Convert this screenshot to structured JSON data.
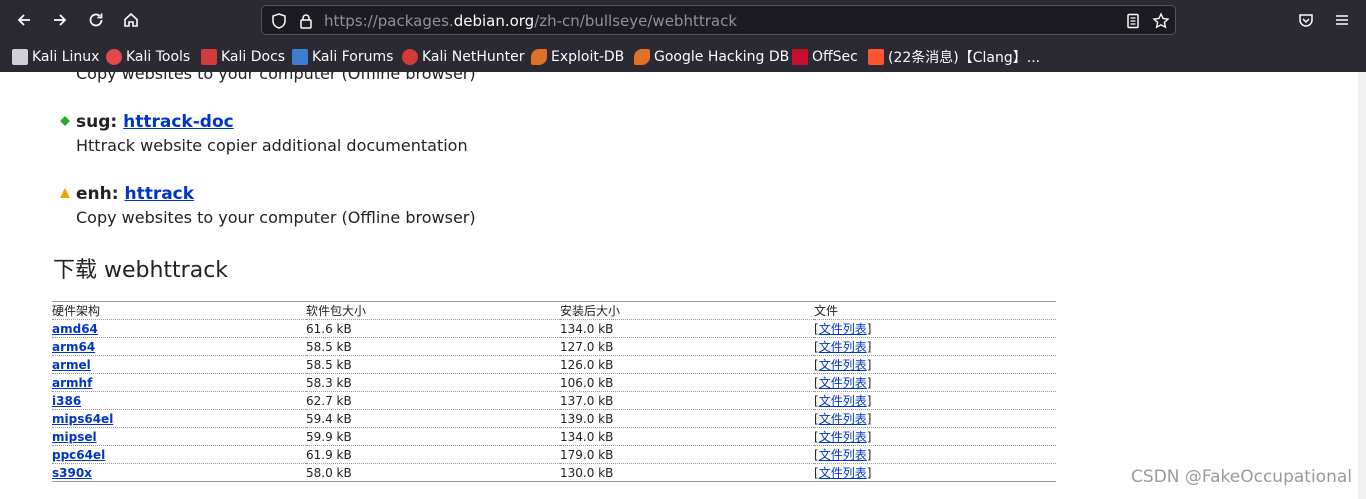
{
  "browser": {
    "url_prefix": "https://packages.",
    "url_host": "debian.org",
    "url_path": "/zh-cn/bullseye/webhttrack",
    "bookmarks": [
      {
        "label": "Kali Linux",
        "icon": "kali-dragon-icon",
        "color": "#cfcfd8"
      },
      {
        "label": "Kali Tools",
        "icon": "kali-tools-icon",
        "color": "#e04a4a"
      },
      {
        "label": "Kali Docs",
        "icon": "kali-docs-icon",
        "color": "#d33b3b"
      },
      {
        "label": "Kali Forums",
        "icon": "kali-forums-icon",
        "color": "#3b7fd3"
      },
      {
        "label": "Kali NetHunter",
        "icon": "nethunter-icon",
        "color": "#d33b3b"
      },
      {
        "label": "Exploit-DB",
        "icon": "exploitdb-icon",
        "color": "#e0702a"
      },
      {
        "label": "Google Hacking DB",
        "icon": "ghdb-icon",
        "color": "#e0702a"
      },
      {
        "label": "OffSec",
        "icon": "offsec-icon",
        "color": "#c8102e"
      },
      {
        "label": "(22条消息)【Clang】...",
        "icon": "csdn-icon",
        "color": "#fc5531"
      }
    ]
  },
  "deps": {
    "partial_desc": "Copy websites to your computer (Offline browser)",
    "items": [
      {
        "kind": "sug:",
        "pkg": "httrack-doc",
        "desc": "Httrack website copier additional documentation",
        "marker_color": "#2fa82f"
      },
      {
        "kind": "enh:",
        "pkg": "httrack",
        "desc": "Copy websites to your computer (Offline browser)",
        "marker_color": "#f0a400"
      }
    ]
  },
  "download": {
    "title": "下载 webhttrack",
    "headers": [
      "硬件架构",
      "软件包大小",
      "安装后大小",
      "文件"
    ],
    "file_list_label": "文件列表",
    "rows": [
      {
        "arch": "amd64",
        "size": "61.6 kB",
        "installed": "134.0 kB"
      },
      {
        "arch": "arm64",
        "size": "58.5 kB",
        "installed": "127.0 kB"
      },
      {
        "arch": "armel",
        "size": "58.5 kB",
        "installed": "126.0 kB"
      },
      {
        "arch": "armhf",
        "size": "58.3 kB",
        "installed": "106.0 kB"
      },
      {
        "arch": "i386",
        "size": "62.7 kB",
        "installed": "137.0 kB"
      },
      {
        "arch": "mips64el",
        "size": "59.4 kB",
        "installed": "139.0 kB"
      },
      {
        "arch": "mipsel",
        "size": "59.9 kB",
        "installed": "134.0 kB"
      },
      {
        "arch": "ppc64el",
        "size": "61.9 kB",
        "installed": "179.0 kB"
      },
      {
        "arch": "s390x",
        "size": "58.0 kB",
        "installed": "130.0 kB"
      }
    ]
  },
  "watermark": "CSDN @FakeOccupational"
}
